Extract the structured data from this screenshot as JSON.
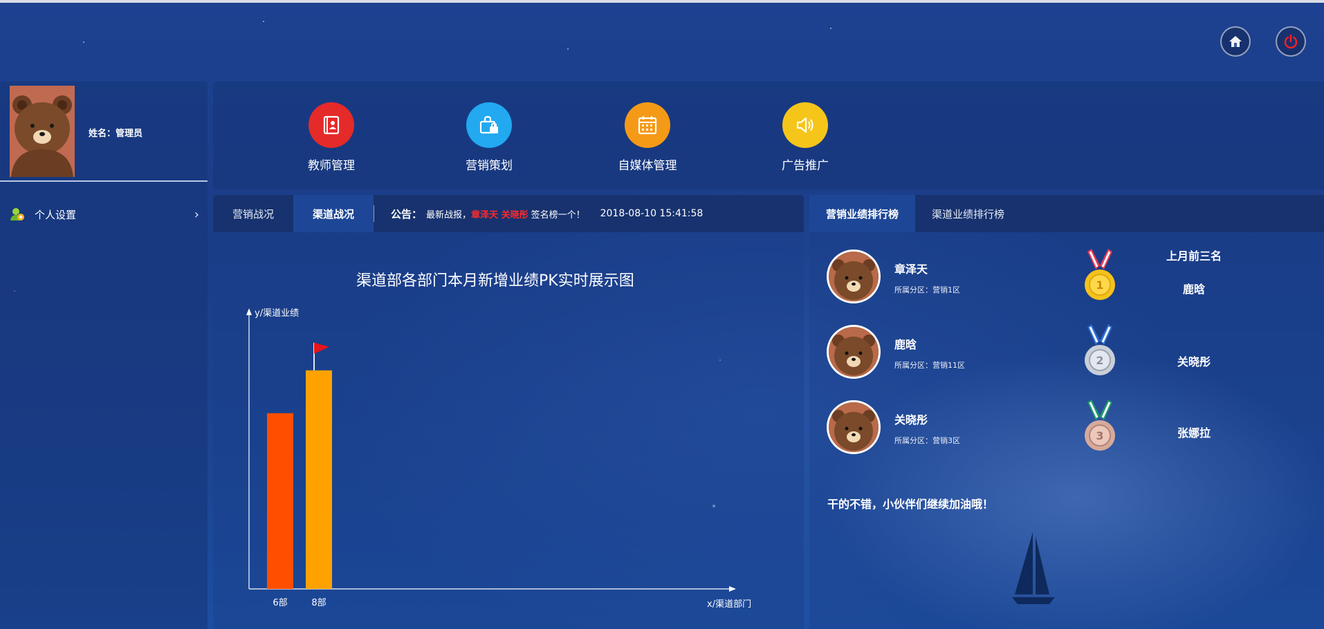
{
  "header": {
    "home_icon": "home-icon",
    "power_icon": "power-icon"
  },
  "profile": {
    "name_label": "姓名：管理员"
  },
  "menu": {
    "items": [
      {
        "label": "个人设置",
        "icon": "person-settings-icon",
        "arrow": "›"
      }
    ]
  },
  "nav": {
    "items": [
      {
        "label": "教师管理",
        "icon": "contacts-book-icon",
        "color": "#e52a2a"
      },
      {
        "label": "营销策划",
        "icon": "lock-briefcase-icon",
        "color": "#22a9f0"
      },
      {
        "label": "自媒体管理",
        "icon": "calendar-icon",
        "color": "#f59a16"
      },
      {
        "label": "广告推广",
        "icon": "speaker-icon",
        "color": "#f6c51a"
      }
    ]
  },
  "battle": {
    "tabs": [
      {
        "label": "营销战况",
        "active": false
      },
      {
        "label": "渠道战况",
        "active": true
      }
    ],
    "notice": {
      "label": "公告：",
      "prefix": "最新战报，",
      "highlight": "章泽天 关晓彤",
      "suffix": "签名榜一个！",
      "datetime": "2018-08-10 15:41:58",
      "highlight_color": "#ff2a2a"
    }
  },
  "chart_data": {
    "type": "bar",
    "title": "渠道部各部门本月新增业绩PK实时展示图",
    "ylabel": "y/渠道业绩",
    "xlabel": "x/渠道部门",
    "categories": [
      "6部",
      "8部"
    ],
    "values": [
      82,
      102
    ],
    "colors": [
      "#ff4e00",
      "#ffa200"
    ],
    "ylim": [
      0,
      120
    ],
    "leader_flag_icon": "red-flag-icon",
    "grid": false
  },
  "ranking": {
    "tabs": [
      {
        "label": "营销业绩排行榜",
        "active": true
      },
      {
        "label": "渠道业绩排行榜",
        "active": false
      }
    ],
    "entries": [
      {
        "name": "章泽天",
        "area": "所属分区：营销1区",
        "medal": "gold-medal-icon",
        "medal_number": "1"
      },
      {
        "name": "鹿晗",
        "area": "所属分区：营销11区",
        "medal": "silver-medal-icon",
        "medal_number": "2"
      },
      {
        "name": "关晓彤",
        "area": "所属分区：营销3区",
        "medal": "bronze-medal-icon",
        "medal_number": "3"
      }
    ],
    "last_month_title": "上月前三名",
    "last_month": [
      "鹿晗",
      "关晓彤",
      "张娜拉"
    ],
    "cheer": "干的不错，小伙伴们继续加油哦！"
  }
}
